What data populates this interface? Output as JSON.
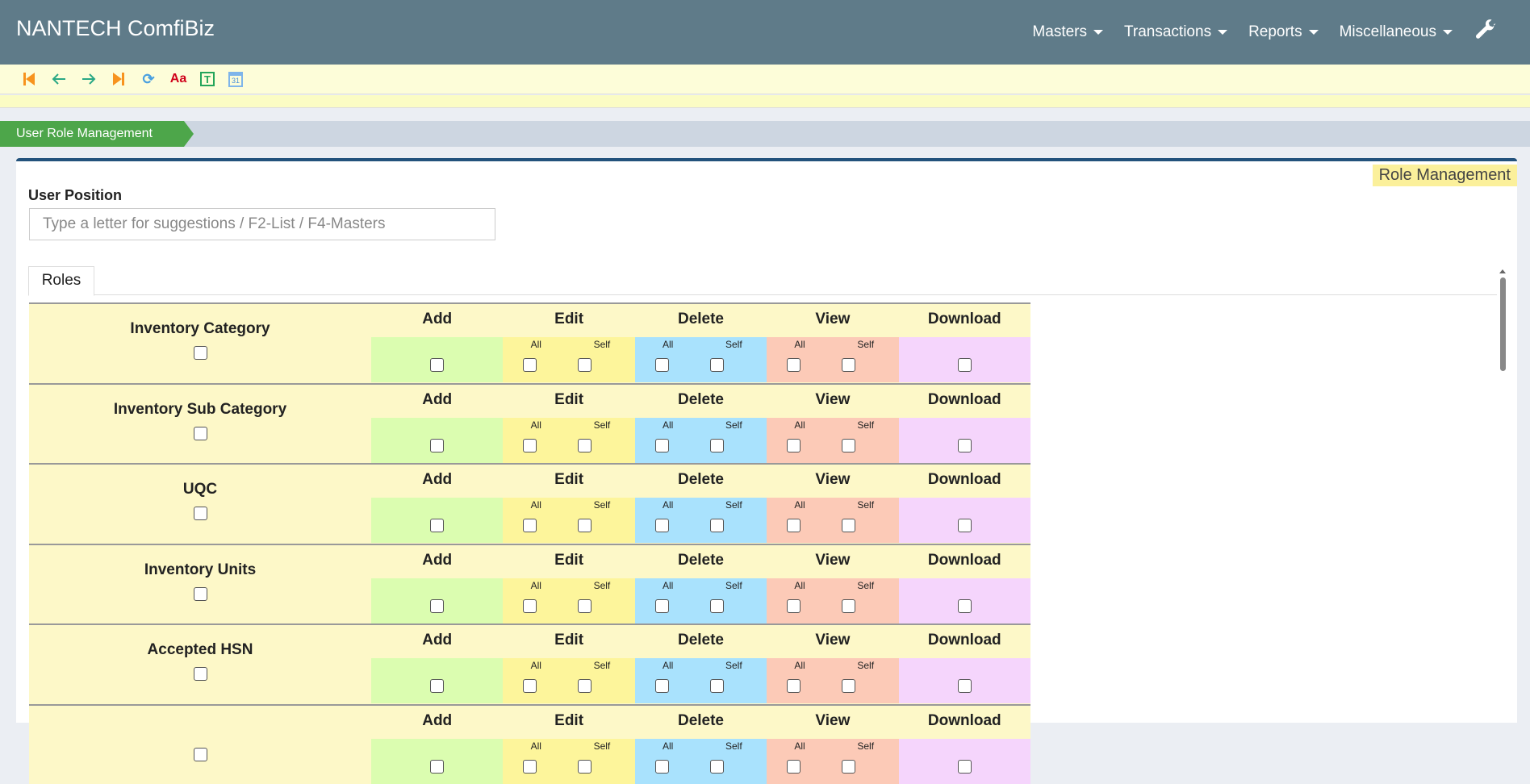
{
  "header": {
    "brand": "NANTECH ComfiBiz",
    "nav": [
      "Masters",
      "Transactions",
      "Reports",
      "Miscellaneous"
    ]
  },
  "toolbar": {
    "icons": [
      "first-record-icon",
      "previous-icon",
      "next-icon",
      "last-record-icon",
      "refresh-icon",
      "font-icon",
      "text-icon",
      "calendar-icon"
    ],
    "calendar_day": "31",
    "font_label": "Aa",
    "text_label": "T"
  },
  "breadcrumb": "User Role Management",
  "panel": {
    "badge": "Role Management",
    "field_label": "User Position",
    "placeholder": "Type a letter for suggestions / F2-List / F4-Masters",
    "tab": "Roles"
  },
  "columns": [
    {
      "label": "Add",
      "color": "#dbfdb0",
      "subs": []
    },
    {
      "label": "Edit",
      "color": "#fdf59b",
      "subs": [
        "All",
        "Self"
      ]
    },
    {
      "label": "Delete",
      "color": "#a9e2fd",
      "subs": [
        "All",
        "Self"
      ]
    },
    {
      "label": "View",
      "color": "#fccab7",
      "subs": [
        "All",
        "Self"
      ]
    },
    {
      "label": "Download",
      "color": "#f5d5fc",
      "subs": []
    }
  ],
  "rows": [
    "Inventory Category",
    "Inventory Sub Category",
    "UQC",
    "Inventory Units",
    "Accepted HSN",
    ""
  ]
}
